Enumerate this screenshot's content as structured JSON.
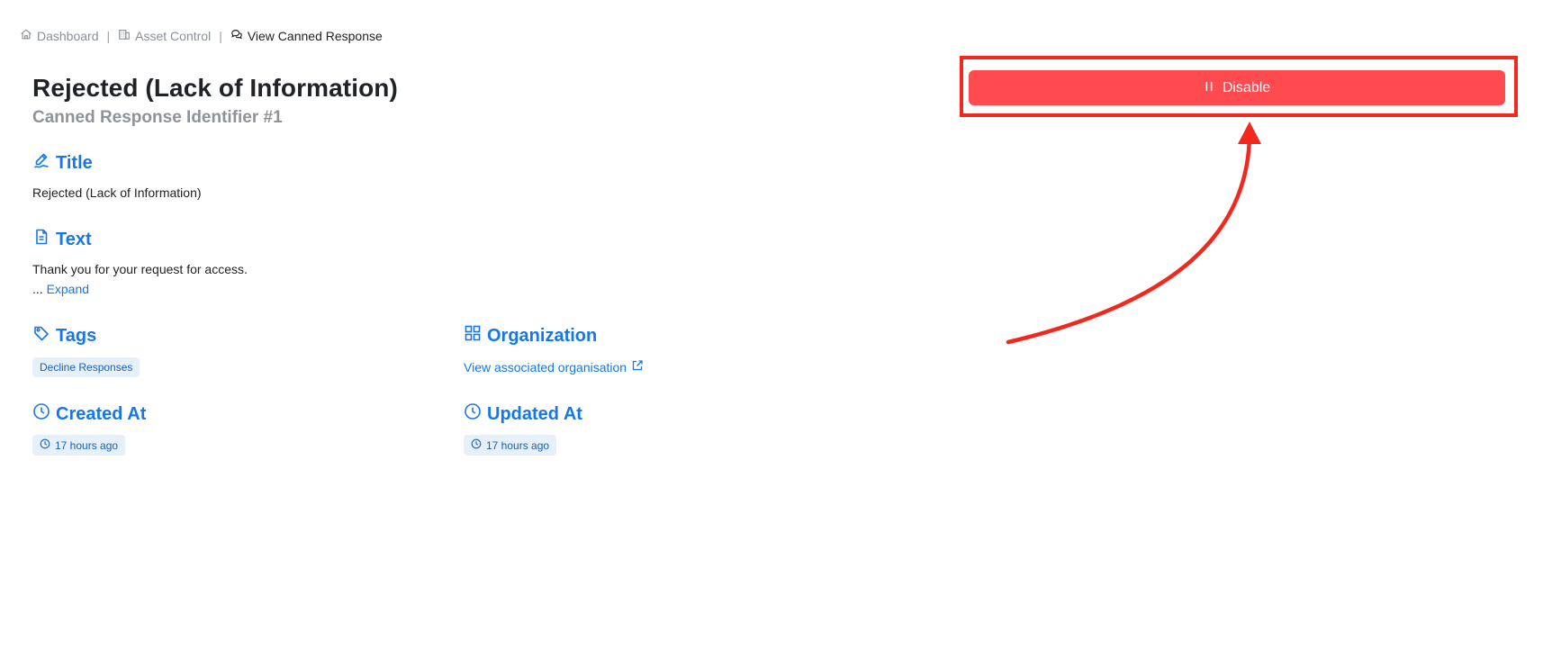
{
  "breadcrumb": {
    "items": [
      {
        "label": "Dashboard",
        "icon": "home-icon"
      },
      {
        "label": "Asset Control",
        "icon": "building-icon"
      },
      {
        "label": "View Canned Response",
        "icon": "chat-bubbles-icon"
      }
    ],
    "separator": "|"
  },
  "header": {
    "title": "Rejected (Lack of Information)",
    "subtitle": "Canned Response Identifier #1"
  },
  "actions": {
    "disable_label": "Disable",
    "disable_icon": "pause-icon",
    "button_color": "#ff4b4f",
    "highlight_color": "#f2281e"
  },
  "sections": {
    "title": {
      "heading": "Title",
      "icon": "signature-pen-icon",
      "value": "Rejected (Lack of Information)"
    },
    "text": {
      "heading": "Text",
      "icon": "document-icon",
      "value": "Thank you for your request for access.",
      "ellipsis": "...",
      "expand_label": "Expand"
    },
    "tags": {
      "heading": "Tags",
      "icon": "tag-icon",
      "items": [
        "Decline Responses"
      ]
    },
    "organization": {
      "heading": "Organization",
      "icon": "grid-icon",
      "link_label": "View associated organisation",
      "link_icon": "external-link-icon"
    },
    "created_at": {
      "heading": "Created At",
      "icon": "clock-icon",
      "value": "17 hours ago"
    },
    "updated_at": {
      "heading": "Updated At",
      "icon": "clock-icon",
      "value": "17 hours ago"
    }
  },
  "colors": {
    "accent": "#1677e6",
    "tag_bg": "#e6f0fb",
    "muted": "#8f9399"
  }
}
